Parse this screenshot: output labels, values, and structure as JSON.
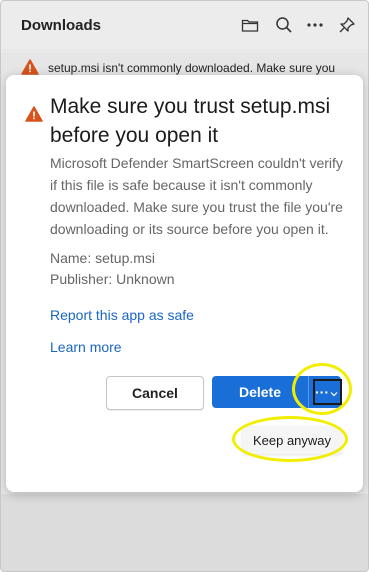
{
  "header": {
    "title": "Downloads",
    "icons": [
      "folder-icon",
      "search-icon",
      "more-icon",
      "pin-icon"
    ]
  },
  "banner": {
    "text": "setup.msi isn't commonly downloaded. Make sure you"
  },
  "dialog": {
    "title": "Make sure you trust setup.msi before you open it",
    "body": "Microsoft Defender SmartScreen couldn't verify if this file is safe because it isn't commonly downloaded. Make sure you trust the file you're downloading or its source before you open it.",
    "name_line": "Name: setup.msi",
    "publisher_line": "Publisher: Unknown",
    "report_link": "Report this app as safe",
    "learn_link": "Learn more",
    "cancel_label": "Cancel",
    "delete_label": "Delete",
    "more_label": "···",
    "keep_label": "Keep anyway"
  },
  "colors": {
    "accent": "#1a6ed8",
    "link": "#1a66c2",
    "warning": "#d9531e",
    "highlight": "#f2ee00"
  }
}
